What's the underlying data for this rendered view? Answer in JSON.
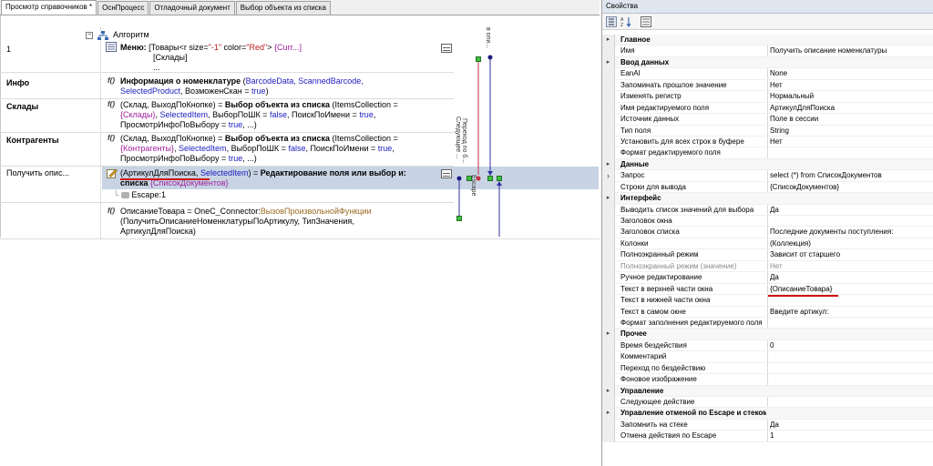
{
  "tabs": [
    {
      "label": "Просмотр справочников *"
    },
    {
      "label": "ОснПроцесс"
    },
    {
      "label": "Отладочный документ"
    },
    {
      "label": "Выбор объекта из списка"
    }
  ],
  "algorithm": {
    "title": "Алгоритм",
    "rows": [
      {
        "label": "1",
        "bold": false
      },
      {
        "label": "Инфо",
        "bold": true
      },
      {
        "label": "Склады",
        "bold": true
      },
      {
        "label": "Контрагенты",
        "bold": true
      },
      {
        "label": "Получить опис...",
        "bold": false
      }
    ],
    "menu": {
      "prefix": "Меню:",
      "line1_a": "[Товары<r size=",
      "line1_b": "\"-1\"",
      "line1_c": " color=",
      "line1_d": "\"Red\"",
      "line1_e": "> ",
      "line1_f": "{Curr...]",
      "line2": "[Склады]",
      "line3": "..."
    },
    "info": {
      "b": "Информация о номенклатуре",
      "a1": " (",
      "p1": "BarcodeData, ScannedBarcode,",
      "p2": "SelectedProduct",
      "p3": ", ВозможенСкан = ",
      "p4": "true",
      "p5": ")"
    },
    "sklady": {
      "l1a": "(Склад, ВыходПоКнопке) = ",
      "l1b": "Выбор объекта из списка",
      "l1c": " (ItemsCollection =",
      "l2a": "{Склады}",
      "l2b": ", ",
      "l2c": "SelectedItem",
      "l2d": ", ВыборПоШК = ",
      "l2e": "false",
      "l2f": ", ПоискПоИмени = ",
      "l2g": "true",
      "l2h": ",",
      "l3a": "ПросмотрИнфоПоВыбору = ",
      "l3b": "true",
      "l3c": ", ...)"
    },
    "kontr": {
      "l1a": "(Склад, ВыходПоКнопке) = ",
      "l1b": "Выбор объекта из списка",
      "l1c": " (ItemsCollection =",
      "l2a": "{Контрагенты}",
      "l2b": ", ",
      "l2c": "SelectedItem",
      "l2d": ", ВыборПоШК = ",
      "l2e": "false",
      "l2f": ", ПоискПоИмени = ",
      "l2g": "true",
      "l2h": ",",
      "l3a": "ПросмотрИнфоПоВыбору = ",
      "l3b": "true",
      "l3c": ", ...)"
    },
    "edit": {
      "l1a": "(АртикулДляПоиска",
      "l1b": ", ",
      "l1c": "SelectedItem",
      "l1d": ") = ",
      "l1e": "Редактирование поля или выбор и:",
      "l2a": "списка",
      "l2b": " {СписокДокументов}"
    },
    "escape": "Escape:1",
    "opis": {
      "l1a": "ОписаниеТовара = OneC_Connector:",
      "l1b": "ВызовПроизвольнойФункции",
      "l2": "(ПолучитьОписаниеНоменклатурыПоАртикулу, ТипЗначения,",
      "l3": "АртикулДляПоиска)"
    },
    "fx_label": "f()",
    "flow_labels": {
      "top": "в опи...",
      "mid1": "Переход по б...",
      "mid2": "Следующее ...",
      "esc": "Escape"
    }
  },
  "properties": {
    "title": "Свойства",
    "rows": [
      {
        "type": "cat",
        "name": "Главное"
      },
      {
        "type": "prop",
        "name": "Имя",
        "value": "Получить описание номенклатуры"
      },
      {
        "type": "cat",
        "name": "Ввод данных"
      },
      {
        "type": "prop",
        "name": "EanAI",
        "value": "None"
      },
      {
        "type": "prop",
        "name": "Запоминать прошлое значение",
        "value": "Нет"
      },
      {
        "type": "prop",
        "name": "Изменять регистр",
        "value": "Нормальный"
      },
      {
        "type": "prop",
        "name": "Имя редактируемого поля",
        "value": "АртикулДляПоиска"
      },
      {
        "type": "prop",
        "name": "Источник данных",
        "value": "Поле в сессии"
      },
      {
        "type": "prop",
        "name": "Тип поля",
        "value": "String"
      },
      {
        "type": "prop",
        "name": "Установить для всех строк в буфере",
        "value": "Нет"
      },
      {
        "type": "prop",
        "name": "Формат редактируемого поля",
        "value": ""
      },
      {
        "type": "cat",
        "name": "Данные"
      },
      {
        "type": "prop",
        "name": "Запрос",
        "value": "select (*) from СписокДокументов",
        "expand": true
      },
      {
        "type": "prop",
        "name": "Строки для вывода",
        "value": "{СписокДокументов}"
      },
      {
        "type": "cat",
        "name": "Интерфейс"
      },
      {
        "type": "prop",
        "name": "Выводить список значений для выбора",
        "value": "Да"
      },
      {
        "type": "prop",
        "name": "Заголовок окна",
        "value": ""
      },
      {
        "type": "prop",
        "name": "Заголовок списка",
        "value": "Последние документы поступления:"
      },
      {
        "type": "prop",
        "name": "Колонки",
        "value": "(Коллекция)"
      },
      {
        "type": "prop",
        "name": "Полноэкранный режим",
        "value": "Зависит от старшего"
      },
      {
        "type": "prop",
        "name": "Полноэкранный режим (значение)",
        "value": "Нет",
        "gray": true
      },
      {
        "type": "prop",
        "name": "Ручное редактирование",
        "value": "Да"
      },
      {
        "type": "prop",
        "name": "Текст в верхней части окна",
        "value": "{ОписаниеТовара}"
      },
      {
        "type": "prop",
        "name": "Текст в нижней части окна",
        "value": ""
      },
      {
        "type": "prop",
        "name": "Текст в самом окне",
        "value": "Введите артикул:"
      },
      {
        "type": "prop",
        "name": "Формат заполнения редактируемого поля",
        "value": ""
      },
      {
        "type": "cat",
        "name": "Прочее"
      },
      {
        "type": "prop",
        "name": "Время бездействия",
        "value": "0"
      },
      {
        "type": "prop",
        "name": "Комментарий",
        "value": ""
      },
      {
        "type": "prop",
        "name": "Переход по бездействию",
        "value": ""
      },
      {
        "type": "prop",
        "name": "Фоновое изображение",
        "value": ""
      },
      {
        "type": "cat",
        "name": "Управление"
      },
      {
        "type": "prop",
        "name": "Следующее действие",
        "value": ""
      },
      {
        "type": "cat",
        "name": "Управление отменой по Escape и стеком отмен"
      },
      {
        "type": "prop",
        "name": "Запомнить на стеке",
        "value": "Да"
      },
      {
        "type": "prop",
        "name": "Отмена действия по Escape",
        "value": "1"
      }
    ]
  },
  "colors": {
    "accent_red": "#cc1111",
    "link_blue": "#2020c0",
    "selection": "#c8d4e4"
  }
}
